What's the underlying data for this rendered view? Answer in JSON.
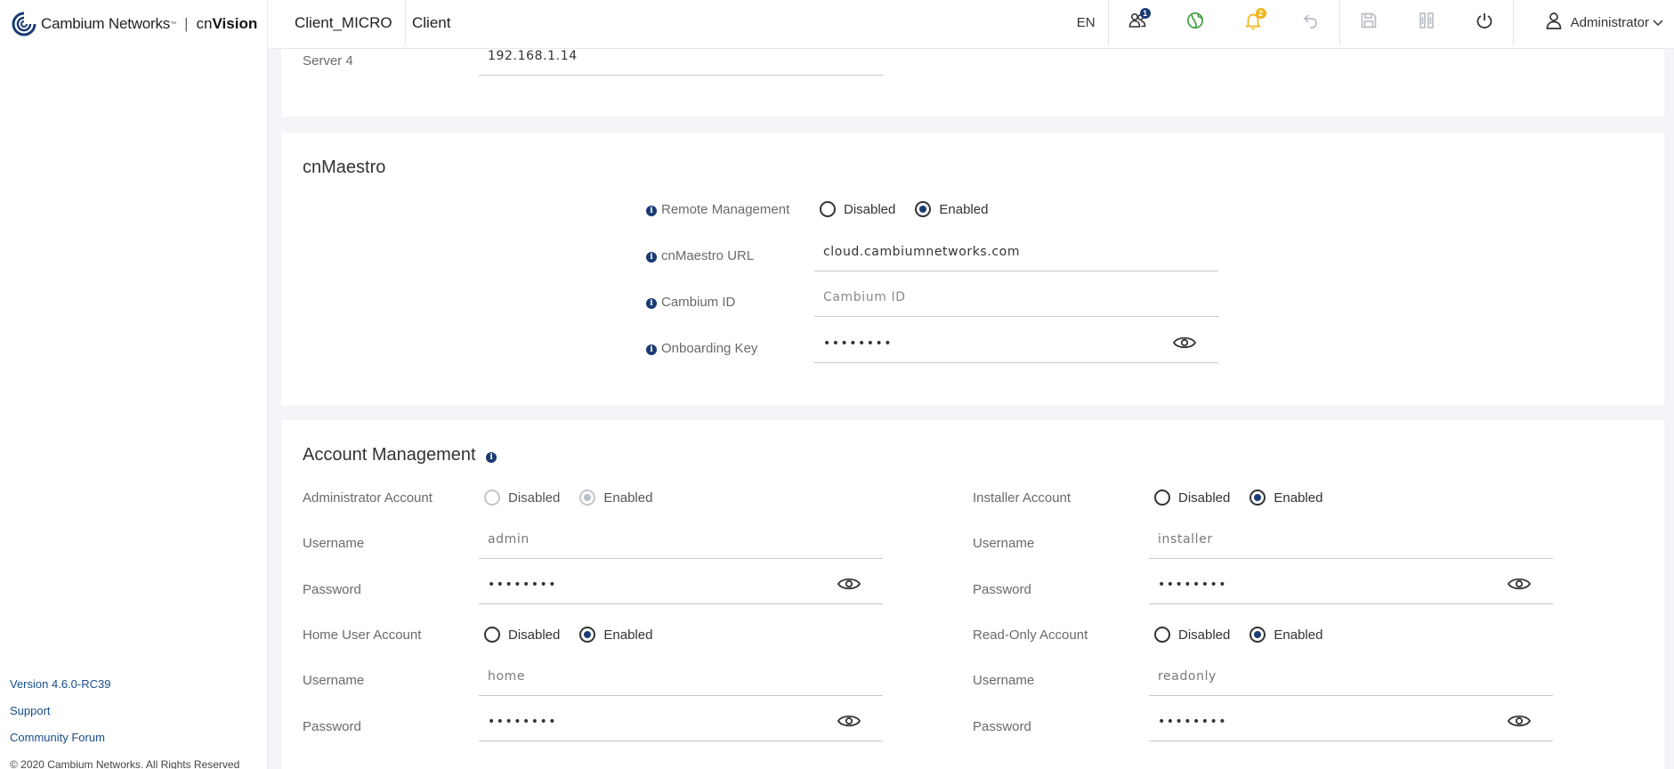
{
  "brand": {
    "company": "Cambium Networks",
    "tm": "™",
    "sep": "|",
    "product_prefix": "cn",
    "product_suffix": "Vision"
  },
  "sidebar": {
    "links": [
      {
        "label": "Version 4.6.0-RC39"
      },
      {
        "label": "Support"
      },
      {
        "label": "Community Forum"
      }
    ],
    "copyright": "© 2020 Cambium Networks. All Rights Reserved"
  },
  "header": {
    "device_name": "Client_MICRO",
    "mode": "Client",
    "language": "EN",
    "clients_badge": "1",
    "alerts_badge": "2",
    "user": "Administrator"
  },
  "top_section": {
    "server4_label": "Server 4",
    "server4_value": "192.168.1.14"
  },
  "cnmaestro": {
    "title": "cnMaestro",
    "remote_mgmt_label": "Remote Management",
    "url_label": "cnMaestro URL",
    "url_value": "cloud.cambiumnetworks.com",
    "cambium_id_label": "Cambium ID",
    "cambium_id_placeholder": "Cambium ID",
    "onboarding_key_label": "Onboarding Key",
    "onboarding_key_value": "password"
  },
  "radio_labels": {
    "disabled": "Disabled",
    "enabled": "Enabled"
  },
  "account_mgmt": {
    "title": "Account Management",
    "admin_account_label": "Administrator Account",
    "installer_account_label": "Installer Account",
    "home_account_label": "Home User Account",
    "readonly_account_label": "Read-Only Account",
    "username_label": "Username",
    "password_label": "Password",
    "admin_username": "admin",
    "installer_username": "installer",
    "home_username": "home",
    "readonly_username": "readonly",
    "password_value": "password"
  }
}
